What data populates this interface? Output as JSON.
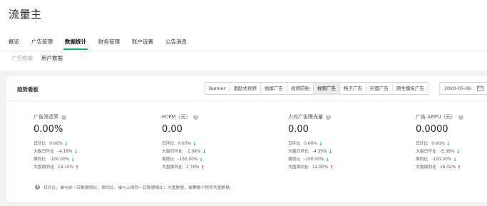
{
  "app": {
    "title": "流量主"
  },
  "main_tabs": [
    {
      "label": "概览"
    },
    {
      "label": "广告管理"
    },
    {
      "label": "数据统计"
    },
    {
      "label": "财务管理"
    },
    {
      "label": "账户设置"
    },
    {
      "label": "公告消息"
    }
  ],
  "active_main_tab": "数据统计",
  "sub_tabs": [
    {
      "label": "广告数据"
    },
    {
      "label": "用户数据"
    }
  ],
  "active_sub_tab": "用户数据",
  "panel": {
    "title": "趋势看板",
    "filters": [
      {
        "label": "Banner"
      },
      {
        "label": "激励式视频"
      },
      {
        "label": "插屏广告"
      },
      {
        "label": "视频前贴"
      },
      {
        "label": "视频广告"
      },
      {
        "label": "格子广告"
      },
      {
        "label": "封面广告"
      },
      {
        "label": "原生模板广告"
      }
    ],
    "active_filter": "视频广告",
    "date": "2020-05-06",
    "metrics": [
      {
        "name": "广告渗透率",
        "value": "0.00%",
        "rows": [
          {
            "label": "日环比",
            "value": "0.00%",
            "trend": "down"
          },
          {
            "label": "大盘日环比",
            "value": "-4.19%",
            "trend": "down"
          },
          {
            "label": "周同比",
            "value": "-100.00%",
            "trend": "down"
          },
          {
            "label": "大盘周同比",
            "value": "14.10%",
            "trend": "up"
          }
        ]
      },
      {
        "name": "eCPM（元）",
        "value": "0.00",
        "rows": [
          {
            "label": "日环比",
            "value": "0.00%",
            "trend": "down"
          },
          {
            "label": "大盘日环比",
            "value": "-1.08%",
            "trend": "down"
          },
          {
            "label": "周同比",
            "value": "-100.00%",
            "trend": "down"
          },
          {
            "label": "大盘周同比",
            "value": "2.76%",
            "trend": "up"
          }
        ]
      },
      {
        "name": "人均广告曝光量",
        "value": "0.00",
        "rows": [
          {
            "label": "日环比",
            "value": "0.00%",
            "trend": "down"
          },
          {
            "label": "大盘日环比",
            "value": "-4.35%",
            "trend": "down"
          },
          {
            "label": "周同比",
            "value": "-100.00%",
            "trend": "down"
          },
          {
            "label": "大盘周同比",
            "value": "12.90%",
            "trend": "up"
          }
        ]
      },
      {
        "name": "广告 ARPU（元）",
        "value": "0.0000",
        "rows": [
          {
            "label": "日环比",
            "value": "0.00%",
            "trend": "down"
          },
          {
            "label": "大盘日环比",
            "value": "-5.38%",
            "trend": "down"
          },
          {
            "label": "周同比",
            "value": "-100.00%",
            "trend": "down"
          },
          {
            "label": "大盘周同比",
            "value": "16.02%",
            "trend": "up"
          }
        ]
      }
    ],
    "footnote": "日环比，操与前一日数据相比；周同比，操与上周同一日数据相比；大盘数据，操腾微小程序大盘数据。"
  },
  "colors": {
    "accent": "#07c160",
    "up": "#e64340",
    "down": "#07c160"
  },
  "icons": {
    "help": "question-circle-icon",
    "info": "info-circle-icon",
    "calendar": "calendar-icon",
    "trend_up": "arrow-up-icon",
    "trend_down": "arrow-down-icon"
  }
}
